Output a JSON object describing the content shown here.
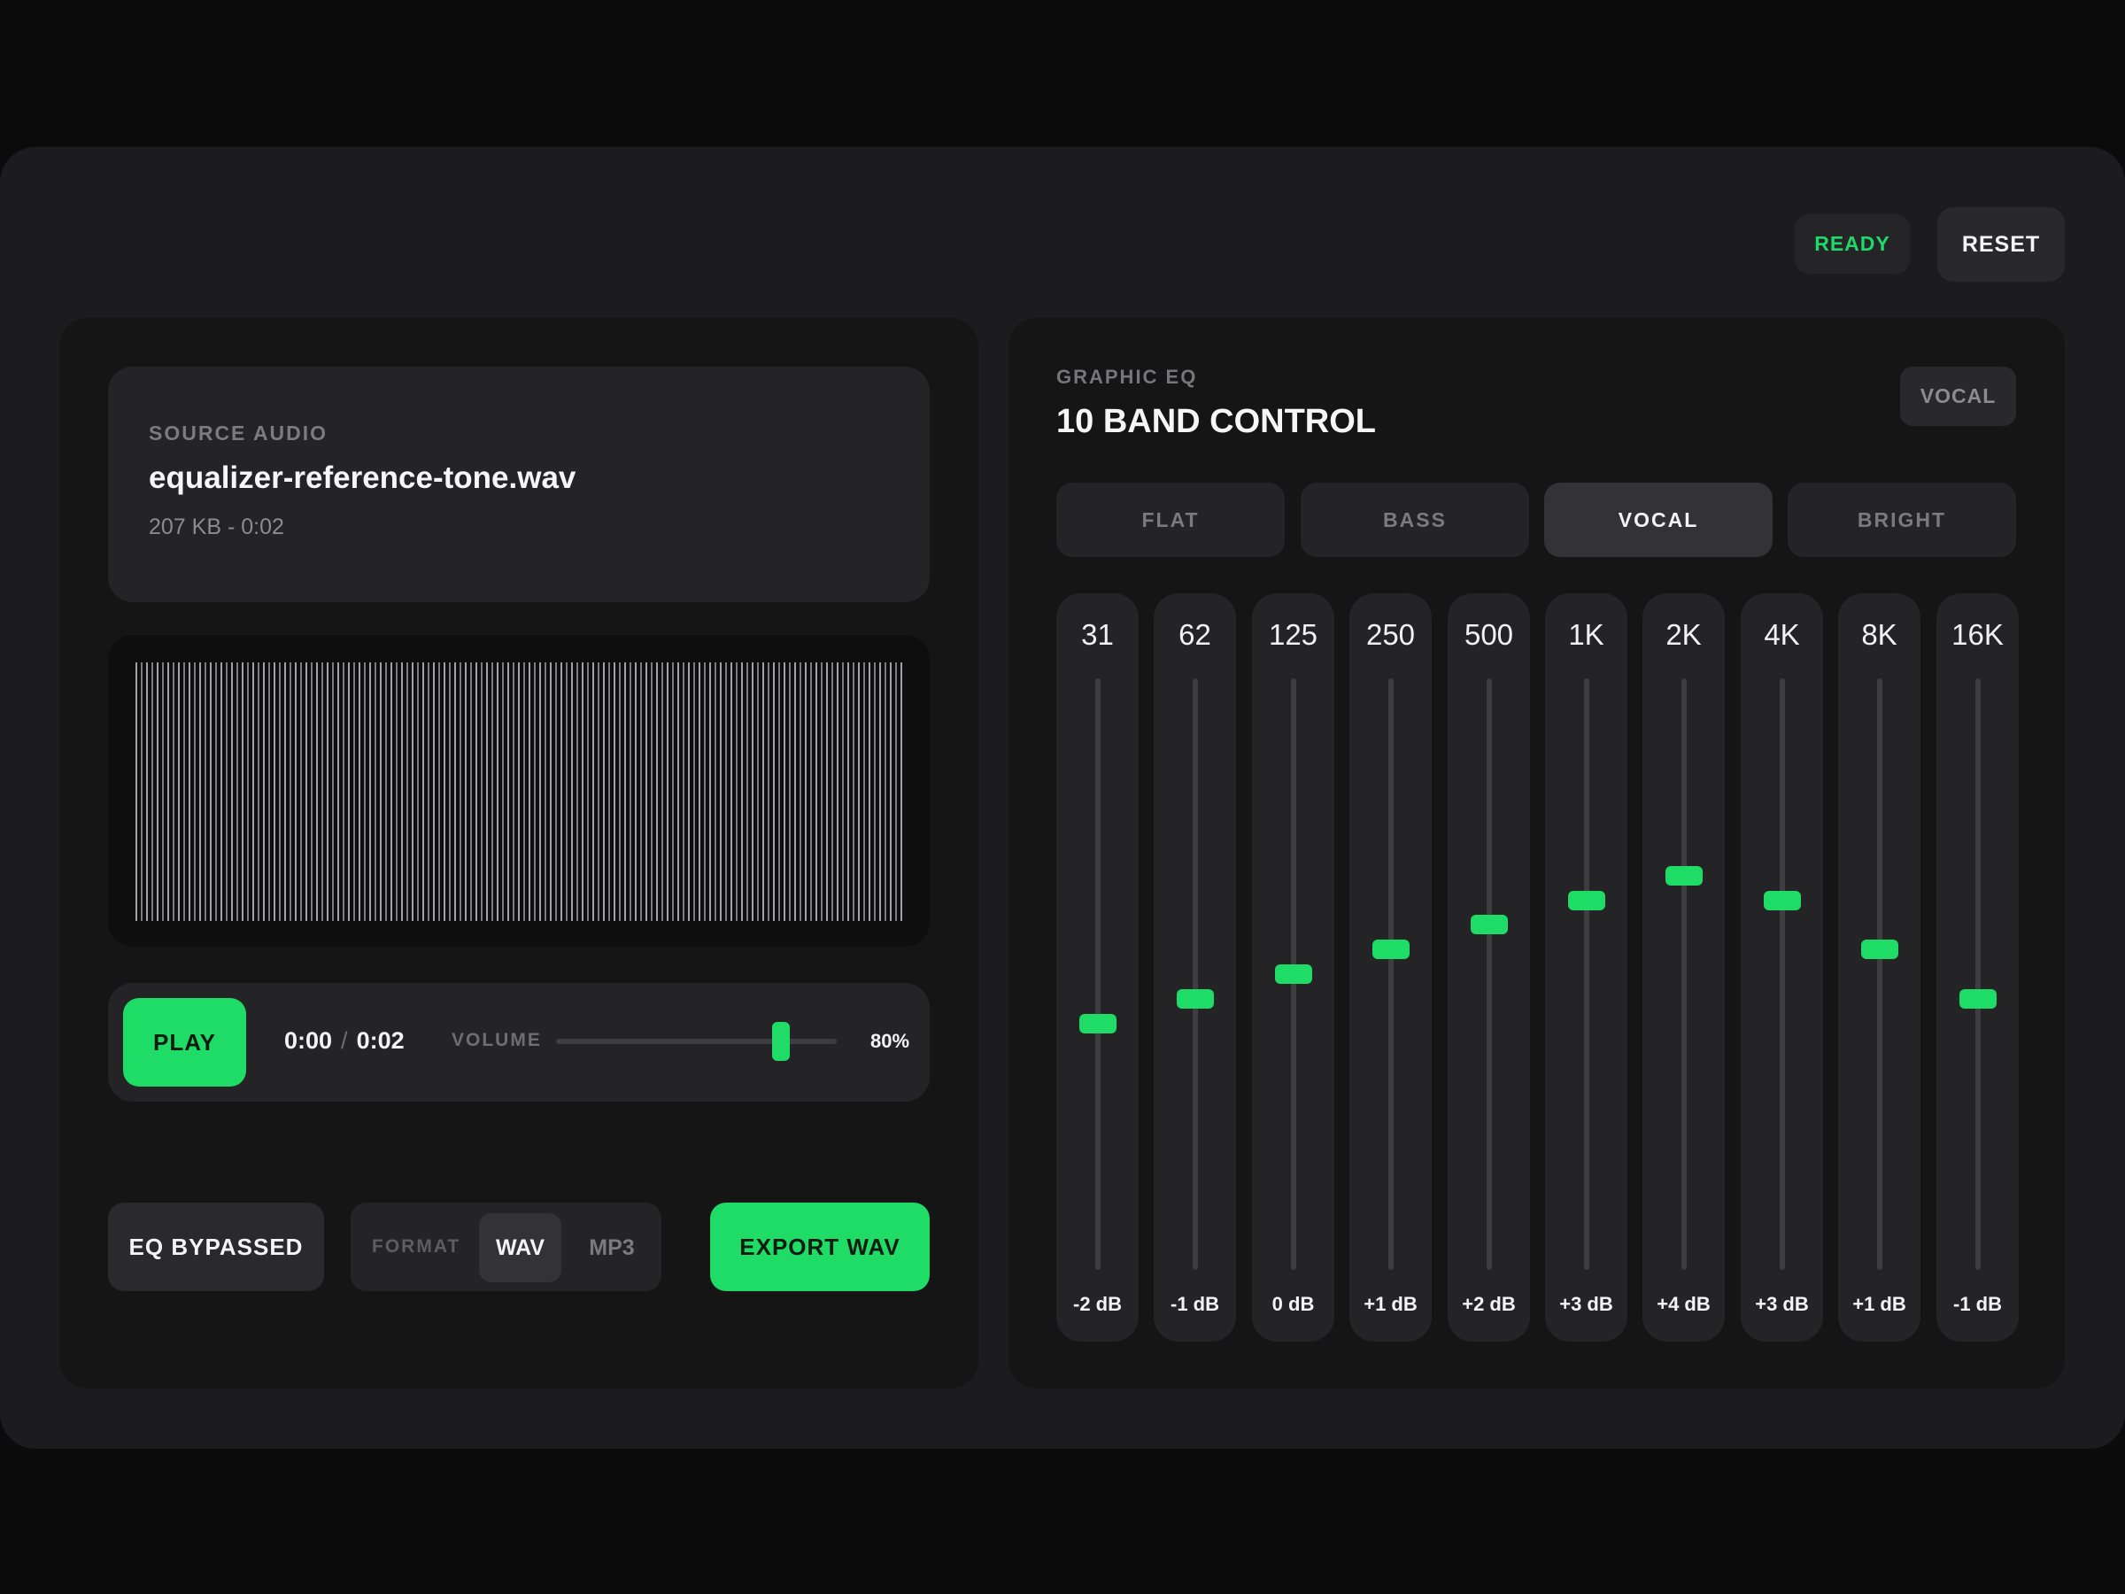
{
  "header": {
    "status": "READY",
    "reset_label": "RESET"
  },
  "source": {
    "kicker": "SOURCE AUDIO",
    "file_name": "equalizer-reference-tone.wav",
    "meta": "207 KB - 0:02"
  },
  "transport": {
    "play_label": "PLAY",
    "current_time": "0:00",
    "separator": "/",
    "duration": "0:02",
    "volume_label": "VOLUME",
    "volume_value": "80%",
    "volume_fraction": 0.8
  },
  "footer": {
    "bypass_label": "EQ BYPASSED",
    "format_label": "FORMAT",
    "formats": [
      "WAV",
      "MP3"
    ],
    "selected_format": "WAV",
    "export_label": "EXPORT WAV"
  },
  "eq": {
    "kicker": "GRAPHIC EQ",
    "title": "10 BAND CONTROL",
    "badge": "VOCAL",
    "presets": [
      "FLAT",
      "BASS",
      "VOCAL",
      "BRIGHT"
    ],
    "active_preset": "VOCAL",
    "range_db": [
      -12,
      12
    ],
    "bands": [
      {
        "freq": "31",
        "gain_label": "-2 dB",
        "gain": -2
      },
      {
        "freq": "62",
        "gain_label": "-1 dB",
        "gain": -1
      },
      {
        "freq": "125",
        "gain_label": "0 dB",
        "gain": 0
      },
      {
        "freq": "250",
        "gain_label": "+1 dB",
        "gain": 1
      },
      {
        "freq": "500",
        "gain_label": "+2 dB",
        "gain": 2
      },
      {
        "freq": "1K",
        "gain_label": "+3 dB",
        "gain": 3
      },
      {
        "freq": "2K",
        "gain_label": "+4 dB",
        "gain": 4
      },
      {
        "freq": "4K",
        "gain_label": "+3 dB",
        "gain": 3
      },
      {
        "freq": "8K",
        "gain_label": "+1 dB",
        "gain": 1
      },
      {
        "freq": "16K",
        "gain_label": "-1 dB",
        "gain": -1
      }
    ]
  },
  "colors": {
    "accent": "#1fdc66",
    "background": "#0b0b0c",
    "panel": "#151516",
    "card": "#242427"
  }
}
